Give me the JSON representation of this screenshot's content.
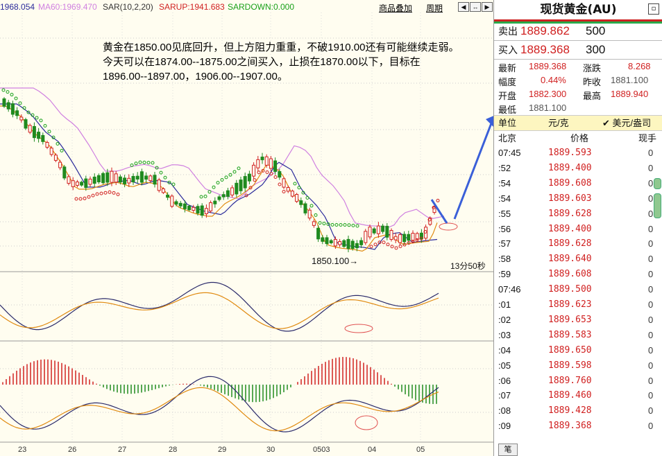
{
  "legend": {
    "ma_a": "1968.054",
    "ma60": "MA60:1969.470",
    "sar": "SAR(10,2,20)",
    "sarup": "SARUP:1941.683",
    "sardown": "SARDOWN:0.000"
  },
  "toolbar": {
    "overlay_label": "商品叠加",
    "period_label": "周期"
  },
  "note_text": "黄金在1850.00见底回升，但上方阻力重重，不破1910.00还有可能继续走弱。\n今天可以在1874.00--1875.00之间买入，止损在1870.00以下，目标在\n1896.00--1897.00，1906.00--1907.00。",
  "low_label": "1850.100→",
  "timer": "13分50秒",
  "x_labels": [
    "23",
    "26",
    "27",
    "28",
    "29",
    "30",
    "0503",
    "04",
    "05"
  ],
  "colors": {
    "up": "#d02020",
    "down": "#1f8a1f",
    "ma_blue": "#2a2a9a",
    "ma_orange": "#e08a10",
    "ma60": "#d080e0",
    "sar_green": "#18a018",
    "sar_red": "#d02020",
    "arrow": "#3a5fd8"
  },
  "panel": {
    "title": "现货黄金(AU)",
    "sell_label": "卖出",
    "sell_price": "1889.862",
    "sell_qty": "500",
    "buy_label": "买入",
    "buy_price": "1889.368",
    "buy_qty": "300",
    "stats": [
      {
        "l1": "最新",
        "v1": "1889.368",
        "l2": "涨跌",
        "v2": "8.268"
      },
      {
        "l1": "幅度",
        "v1": "0.44%",
        "l2": "昨收",
        "v2": "1881.100"
      },
      {
        "l1": "开盘",
        "v1": "1882.300",
        "l2": "最高",
        "v2": "1889.940"
      },
      {
        "l1": "最低",
        "v1": "1881.100",
        "l2": "",
        "v2": ""
      }
    ],
    "unit_label": "单位",
    "unit_value": "元/克",
    "unit_check": "✔ 美元/盎司",
    "col_place": "北京",
    "col_price": "价格",
    "col_hand": "现手",
    "ticks": [
      {
        "t": "07:45",
        "p": "1889.593",
        "v": "0"
      },
      {
        "t": ":52",
        "p": "1889.400",
        "v": "0"
      },
      {
        "t": ":54",
        "p": "1889.608",
        "v": "0"
      },
      {
        "t": ":54",
        "p": "1889.603",
        "v": "0"
      },
      {
        "t": ":55",
        "p": "1889.628",
        "v": "0"
      },
      {
        "t": ":56",
        "p": "1889.400",
        "v": "0"
      },
      {
        "t": ":57",
        "p": "1889.628",
        "v": "0"
      },
      {
        "t": ":58",
        "p": "1889.640",
        "v": "0"
      },
      {
        "t": ":59",
        "p": "1889.608",
        "v": "0"
      },
      {
        "t": "07:46",
        "p": "1889.500",
        "v": "0"
      },
      {
        "t": ":01",
        "p": "1889.623",
        "v": "0"
      },
      {
        "t": ":02",
        "p": "1889.653",
        "v": "0"
      },
      {
        "t": ":03",
        "p": "1889.583",
        "v": "0"
      },
      {
        "t": ":04",
        "p": "1889.650",
        "v": "0"
      },
      {
        "t": ":05",
        "p": "1889.598",
        "v": "0"
      },
      {
        "t": ":06",
        "p": "1889.760",
        "v": "0"
      },
      {
        "t": ":07",
        "p": "1889.460",
        "v": "0"
      },
      {
        "t": ":08",
        "p": "1889.428",
        "v": "0"
      },
      {
        "t": ":09",
        "p": "1889.368",
        "v": "0"
      }
    ],
    "bottom_tab": "笔"
  }
}
